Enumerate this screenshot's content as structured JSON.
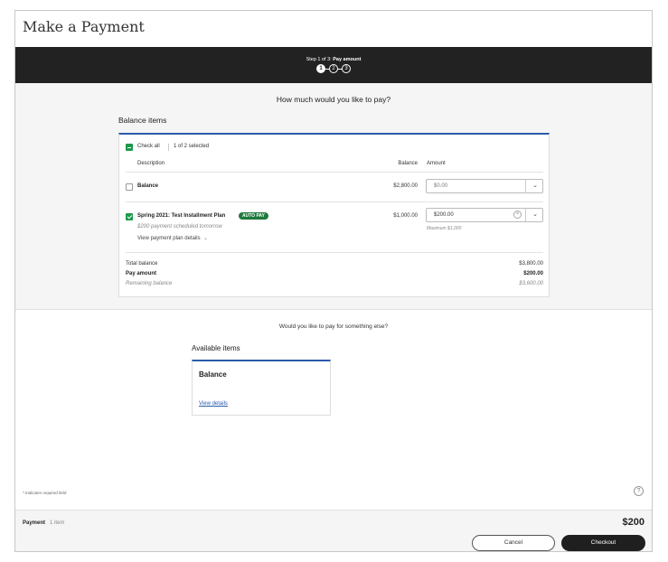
{
  "page": {
    "title": "Make a Payment"
  },
  "stepper": {
    "text_prefix": "Step 1 of 3:",
    "text_current": "Pay amount",
    "steps": [
      "1",
      "2",
      "3"
    ],
    "active_step": 1
  },
  "payment_section": {
    "question": "How much would you like to pay?",
    "heading": "Balance items",
    "check_all_label": "Check all",
    "selected_count": "1 of 2 selected",
    "columns": {
      "description": "Description",
      "balance": "Balance",
      "amount": "Amount"
    },
    "items": [
      {
        "name": "Balance",
        "balance": "$2,800.00",
        "amount_placeholder": "$0.00",
        "checked": false
      },
      {
        "name": "Spring 2021: Test Installment Plan",
        "badge": "AUTO PAY",
        "note": "$200 payment scheduled tomorrow",
        "details_link": "View payment plan details",
        "balance": "$1,000.00",
        "amount": "$200.00",
        "helper": "Maximum $1,000",
        "checked": true
      }
    ],
    "summary": {
      "total_balance_label": "Total balance",
      "total_balance_value": "$3,800.00",
      "pay_amount_label": "Pay amount",
      "pay_amount_value": "$200.00",
      "remaining_label": "Remaining balance",
      "remaining_value": "$3,600.00"
    }
  },
  "other_section": {
    "question": "Would you like to pay for something else?",
    "heading": "Available items",
    "card_title": "Balance",
    "card_link": "View details"
  },
  "footer": {
    "required_note": "* Indicates required field",
    "payment_label": "Payment",
    "item_count": "1 item",
    "total": "$200",
    "cancel_label": "Cancel",
    "checkout_label": "Checkout"
  },
  "colors": {
    "accent": "#2a5caa",
    "success": "#1e9a4a",
    "dark": "#222222"
  }
}
